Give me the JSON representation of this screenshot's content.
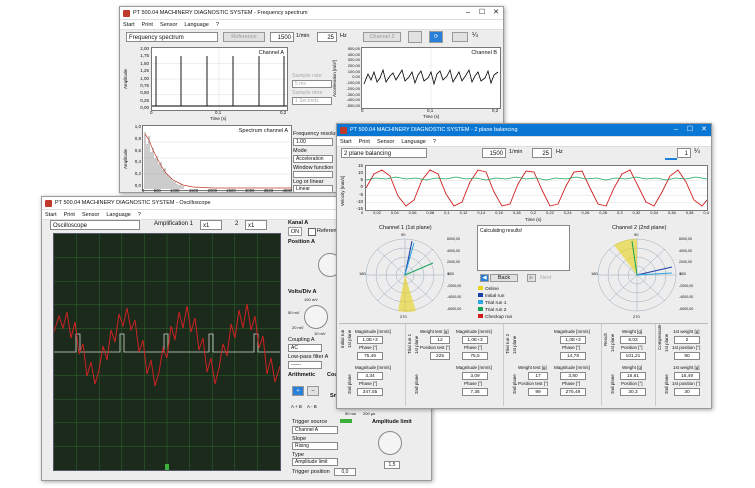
{
  "windows": {
    "freq": {
      "title": "PT 500.04 MACHINERY DIAGNOSTIC SYSTEM - Frequency spectrum",
      "menu": [
        "Start",
        "Print",
        "Sensor",
        "Language",
        "?"
      ],
      "mode_name": "Frequency spectrum",
      "reference_label": "Reference",
      "rpm_value": "1500",
      "rpm_unit": "1/min",
      "hz_value": "25",
      "hz_unit": "Hz",
      "channel2_label": "Channel 2",
      "channel_a_title": "Channel A",
      "channel_b_title": "Channel B",
      "spectrum_title": "Spectrum channel A",
      "time_label": "Time (s)",
      "amplitude_label": "Amplitude",
      "accel_label": "Acceleration [m/s²]",
      "sample_rate_label": "Sample rate",
      "sample_rate_value": "5 ms",
      "sample_time_label": "Sample time",
      "sample_time_value": "1 Seconds",
      "freq_res_label": "Frequency resolution",
      "freq_res_value": "1.00",
      "mode_label": "Mode",
      "mode_value": "Acceleration",
      "window_label": "Window function",
      "log_label": "Log or linear",
      "log_value": "Linear",
      "a_yticks": [
        "2,00",
        "1,75",
        "1,50",
        "1,25",
        "1,00",
        "0,75",
        "0,50",
        "0,25",
        "0,00"
      ],
      "a_xticks": [
        "0",
        "0,1",
        "0,2"
      ],
      "b_yticks": [
        "500,00",
        "400,00",
        "300,00",
        "200,00",
        "100,00",
        "0,00",
        "-100,00",
        "-200,00",
        "-300,00",
        "-400,00",
        "-500,00"
      ],
      "b_xticks": [
        "0",
        "0,1",
        "0,2"
      ],
      "s_yticks": [
        "1,0",
        "0,8",
        "0,6",
        "0,4",
        "0,2",
        "0,0"
      ],
      "s_xticks": [
        "0",
        "500",
        "1000",
        "1500",
        "2000",
        "2500",
        "3000",
        "3500",
        "4000"
      ]
    },
    "osc": {
      "title": "PT 500.04 MACHINERY DIAGNOSTIC SYSTEM - Oscilloscope",
      "menu": [
        "Start",
        "Print",
        "Sensor",
        "Language",
        "?"
      ],
      "mode_name": "Oscilloscope",
      "amp1_label": "Amplification 1",
      "amp1_value": "x1",
      "amp2_label": "2",
      "amp2_value": "x1",
      "kanal_label": "Kanal A",
      "on_label": "ON",
      "reference_label": "Referen",
      "position_label": "Position A",
      "volts_label": "Volts/Div A",
      "volts_scale": [
        "100 mV",
        "50 mV",
        "20 mV",
        "10 mV"
      ],
      "coupling_label": "Coupling A",
      "coupling_value": "AC",
      "lowpass_label": "Low-pass filter A",
      "lowpass_value": "------",
      "arith_label": "Arithmetic",
      "arith_ops": [
        "A + B",
        "A - B"
      ],
      "trigger_source_label": "Trigger source",
      "trigger_source_value": "Channel A",
      "slope_label": "Slope",
      "slope_value": "Rising",
      "type_label": "Type",
      "type_value": "Amplitude limit",
      "trigger_pos_label": "Trigger position",
      "trigger_pos_value": "0,0",
      "amp_limit_label": "Amplitude limit",
      "amp_limit_value": "1,5",
      "time_scale": [
        "50 ms",
        "200 µs"
      ],
      "cou_label": "Cou",
      "sn_label": "Sn"
    },
    "bal": {
      "title": "PT 500.04 MACHINERY DIAGNOSTIC SYSTEM - 2 plane balancing",
      "menu": [
        "Start",
        "Print",
        "Sensor",
        "Language",
        "?"
      ],
      "mode_name": "2 plane balancing",
      "rpm_value": "1500",
      "rpm_unit": "1/min",
      "hz_value": "25",
      "hz_unit": "Hz",
      "counter_value": "1",
      "velocity_label": "Velocity [mm/s]",
      "yticks": [
        "15",
        "10",
        "5",
        "0",
        "-5",
        "-10",
        "-15"
      ],
      "xticks": [
        "0",
        "0,02",
        "0,04",
        "0,06",
        "0,08",
        "0,1",
        "0,12",
        "0,14",
        "0,16",
        "0,18",
        "0,2",
        "0,22",
        "0,24",
        "0,26",
        "0,28",
        "0,3",
        "0,32",
        "0,34",
        "0,36",
        "0,38",
        "0,4"
      ],
      "time_label": "Time (s)",
      "polar1_title": "Channel 1 (1st plane)",
      "polar2_title": "Channel 2 (2nd plane)",
      "polar_ticks": [
        "-6000,00",
        "-4000,00",
        "-2000,00",
        "0,00",
        "2000,00",
        "4000,00",
        "6000,00"
      ],
      "polar_top": "90",
      "polar_bottom": "270",
      "polar_left": "180",
      "polar_right": "0",
      "calc_text": "Calculating results!",
      "back_label": "Back",
      "next_label": "Next",
      "legend": [
        {
          "label": "Online",
          "color": "#e8d21a"
        },
        {
          "label": "Initial run",
          "color": "#1c3fa8"
        },
        {
          "label": "Trial run 1",
          "color": "#2aa6e0"
        },
        {
          "label": "Trial run 2",
          "color": "#18a35a"
        },
        {
          "label": "Checkup run",
          "color": "#d01c1c"
        }
      ],
      "groups": {
        "initial": {
          "side": "Initial run",
          "plane1": "1st plane",
          "plane2": "2nd plane",
          "mag_label": "Magnitude [mm/s]",
          "phase_label": "Phase [°]",
          "p1_mag": "1,0E+3",
          "p1_phase": "75,46",
          "p2_mag": "3,34",
          "p2_phase": "347,55"
        },
        "trial1": {
          "side": "Trial run 1",
          "plane1": "1st plane",
          "plane2": "2nd plane",
          "weight_label": "Weight test [g]",
          "pos_label": "Position test [°]",
          "mag_label": "Magnitude [mm/s]",
          "phase_label": "Phase [°]",
          "weight": "12",
          "position": "225",
          "p1_mag": "1,0E+3",
          "p1_phase": "75,5",
          "p2_mag": "3,09",
          "p2_phase": "7,36"
        },
        "trial2": {
          "side": "Trial run 2",
          "plane1": "1st plane",
          "plane2": "2nd plane",
          "weight_label": "Weight test [g]",
          "pos_label": "Position test [°]",
          "mag_label": "Magnitude [mm/s]",
          "phase_label": "Phase [°]",
          "weight": "17",
          "position": "99",
          "p1_mag": "1,0E+3",
          "p1_phase": "14,78",
          "p2_mag": "3,80",
          "p2_phase": "275,49"
        },
        "result": {
          "side": "Result",
          "plane1": "1st plane",
          "plane2": "2nd plane",
          "weight_label": "Weight [g]",
          "pos_label": "Position [°]",
          "p1_weight": "8,03",
          "p1_pos": "101,21",
          "p2_weight": "16,61",
          "p2_pos": "30,3"
        },
        "comp": {
          "side": "Compensate",
          "plane1": "1st plane",
          "plane2": "2nd plane",
          "weight_label": "1st weight [g]",
          "pos_label": "1st position [°]",
          "p1_weight": "2",
          "p1_pos": "90",
          "p2_weight": "16,49",
          "p2_pos": "30"
        }
      }
    }
  }
}
